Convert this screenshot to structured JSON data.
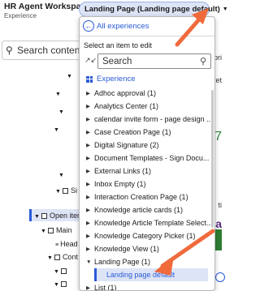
{
  "app": {
    "title": "HR Agent Workspace",
    "subtitle": "Experience"
  },
  "background": {
    "search_placeholder": "Search content",
    "tree": {
      "si_label": "Si",
      "open_item_label": "Open item",
      "main_label": "Main",
      "head_label": "Head",
      "cont_label": "Cont"
    },
    "right_snippets": {
      "top": "pri",
      "mid": "ret",
      "number": "7",
      "bottom": "ti"
    }
  },
  "trigger": {
    "label": "Landing Page (Landing page default)"
  },
  "dropdown": {
    "back_link": "All experiences",
    "hint": "Select an item to edit",
    "search_placeholder": "Search",
    "section_header": "Experience",
    "items": [
      {
        "label": "Adhoc approval (1)"
      },
      {
        "label": "Analytics Center (1)"
      },
      {
        "label": "calendar invite form - page design ..."
      },
      {
        "label": "Case Creation Page (1)"
      },
      {
        "label": "Digital Signature (2)"
      },
      {
        "label": "Document Templates - Sign Docu..."
      },
      {
        "label": "External Links (1)"
      },
      {
        "label": "Inbox Empty (1)"
      },
      {
        "label": "Interaction Creation Page (1)"
      },
      {
        "label": "Knowledge article cards (1)"
      },
      {
        "label": "Knowledge Article Template Select..."
      },
      {
        "label": "Knowledge Category Picker (1)"
      },
      {
        "label": "Knowledge View (1)"
      },
      {
        "label": "Landing Page (1)"
      }
    ],
    "selected_child": "Landing page default",
    "after_items": [
      {
        "label": "List (1)"
      }
    ]
  },
  "colors": {
    "accent": "#2a5bd7",
    "annotation_arrow": "#f06a3c",
    "selection_bg": "#dde4f6"
  }
}
